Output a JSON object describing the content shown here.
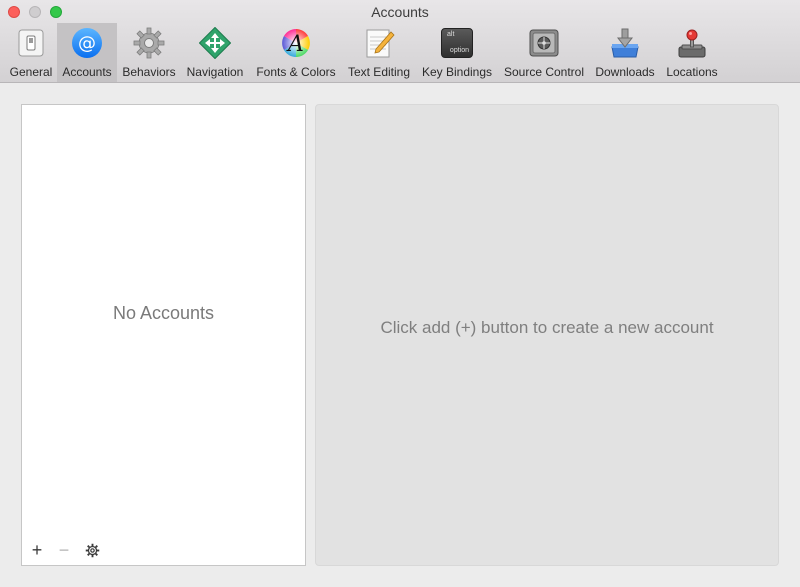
{
  "window": {
    "title": "Accounts"
  },
  "toolbar": {
    "items": [
      {
        "label": "General",
        "icon": "general-switch-icon"
      },
      {
        "label": "Accounts",
        "icon": "at-sign-icon",
        "selected": true
      },
      {
        "label": "Behaviors",
        "icon": "gear-icon"
      },
      {
        "label": "Navigation",
        "icon": "navigation-arrows-icon"
      },
      {
        "label": "Fonts & Colors",
        "icon": "color-wheel-font-icon"
      },
      {
        "label": "Text Editing",
        "icon": "notepad-pencil-icon"
      },
      {
        "label": "Key Bindings",
        "icon": "option-key-icon",
        "key_top": "alt",
        "key_bottom": "option"
      },
      {
        "label": "Source Control",
        "icon": "safe-vault-icon"
      },
      {
        "label": "Downloads",
        "icon": "download-box-icon"
      },
      {
        "label": "Locations",
        "icon": "joystick-icon"
      }
    ]
  },
  "accounts_list": {
    "empty_text": "No Accounts",
    "add_label": "+",
    "remove_label": "−"
  },
  "detail": {
    "hint": "Click add (+) button to create a new account"
  },
  "colors": {
    "selected_tab": "#c4c2c4",
    "accent_blue": "#1a8cff",
    "close": "#fc605c",
    "maximize": "#34c84a"
  }
}
